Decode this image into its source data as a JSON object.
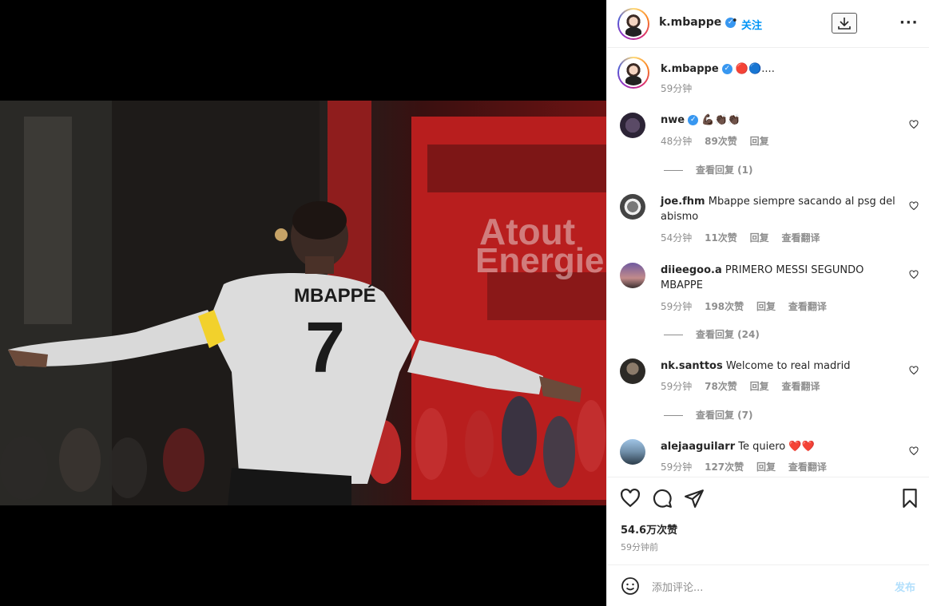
{
  "post": {
    "author": "k.mbappe",
    "follow_label": "关注",
    "separator": "•",
    "verified_mark": "✓"
  },
  "caption": {
    "username": "k.mbappe",
    "text": "🔴🔵....",
    "time": "59分钟"
  },
  "comments": [
    {
      "username": "nwe",
      "verified": true,
      "text": "💪🏿👏🏿👏🏿",
      "time": "48分钟",
      "likes": "89次赞",
      "reply": "回复",
      "translate": "",
      "view_replies": "查看回复 (1)"
    },
    {
      "username": "joe.fhm",
      "verified": false,
      "text": "Mbappe siempre sacando al psg del abismo",
      "time": "54分钟",
      "likes": "11次赞",
      "reply": "回复",
      "translate": "查看翻译",
      "view_replies": ""
    },
    {
      "username": "diieegoo.a",
      "verified": false,
      "text": "PRIMERO MESSI SEGUNDO MBAPPE",
      "time": "59分钟",
      "likes": "198次赞",
      "reply": "回复",
      "translate": "查看翻译",
      "view_replies": "查看回复 (24)"
    },
    {
      "username": "nk.santtos",
      "verified": false,
      "text": "Welcome to real madrid",
      "time": "59分钟",
      "likes": "78次赞",
      "reply": "回复",
      "translate": "查看翻译",
      "view_replies": "查看回复 (7)"
    },
    {
      "username": "alejaaguilarr",
      "verified": false,
      "text": "Te quiero ❤️❤️",
      "time": "59分钟",
      "likes": "127次赞",
      "reply": "回复",
      "translate": "查看翻译",
      "view_replies": ""
    }
  ],
  "stats": {
    "likes": "54.6万次赞",
    "posted": "59分钟前"
  },
  "composer": {
    "placeholder": "添加评论...",
    "post_label": "发布"
  },
  "photo": {
    "jersey_name": "MBAPPÉ",
    "jersey_number": "7",
    "banner_line1": "Atout",
    "banner_line2": "Energie"
  },
  "colors": {
    "accent": "#0095f6",
    "muted": "#8e8e8e",
    "text": "#262626"
  }
}
